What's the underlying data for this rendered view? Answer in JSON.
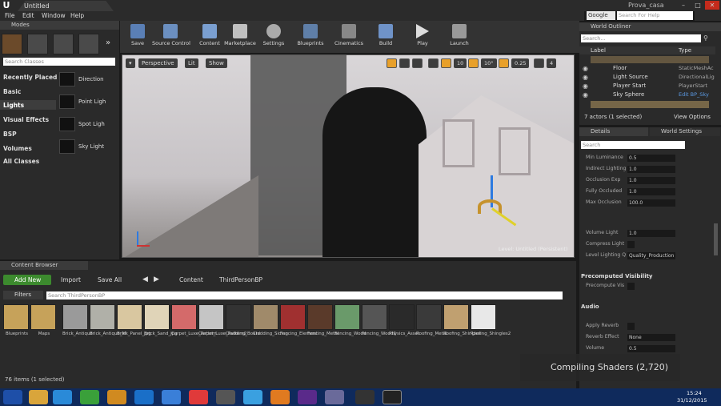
{
  "window": {
    "tab_title": "Untitled",
    "project_name": "Prova_casa",
    "minimize": "–",
    "maximize": "□",
    "close": "✕"
  },
  "menu": {
    "items": [
      "File",
      "Edit",
      "Window",
      "Help"
    ]
  },
  "topright": {
    "search_engine": "Google",
    "search_placeholder": "Search For Help"
  },
  "modes": {
    "tab_label": "Modes",
    "search_placeholder": "Search Classes",
    "categories": [
      "Recently Placed",
      "Basic",
      "Lights",
      "Visual Effects",
      "BSP",
      "Volumes",
      "All Classes"
    ],
    "lights": [
      "Direction",
      "Point Ligh",
      "Spot Ligh",
      "Sky Light"
    ]
  },
  "toolbar": {
    "buttons": [
      "Save",
      "Source Control",
      "Content",
      "Marketplace",
      "Settings",
      "Blueprints",
      "Cinematics",
      "Build",
      "Play",
      "Launch"
    ]
  },
  "viewport": {
    "perspective": "Perspective",
    "lit": "Lit",
    "show": "Show",
    "grid_snap": "10",
    "angle_snap": "10°",
    "scale_snap": "0.25",
    "camera_speed": "4",
    "level_label": "Level: Untitled (Persistent)"
  },
  "outliner": {
    "tab_label": "World Outliner",
    "search_placeholder": "Search...",
    "col_label": "Label",
    "col_type": "Type",
    "rows": [
      {
        "label": "Floor",
        "type": "StaticMeshAc"
      },
      {
        "label": "Light Source",
        "type": "DirectionalLig"
      },
      {
        "label": "Player Start",
        "type": "PlayerStart"
      },
      {
        "label": "Sky Sphere",
        "type": "Edit BP_Sky"
      }
    ],
    "status": "7 actors (1 selected)",
    "view_options": "View Options"
  },
  "details": {
    "tab_details": "Details",
    "tab_world": "World Settings",
    "search_placeholder": "Search",
    "section_precomputed": "Precomputed Visibility",
    "section_audio": "Audio",
    "rows": [
      {
        "label": "Min Luminance",
        "value": "0.5"
      },
      {
        "label": "Indirect Lighting",
        "value": "1.0"
      },
      {
        "label": "Occlusion Exp",
        "value": "1.0"
      },
      {
        "label": "Fully Occluded",
        "value": "1.0"
      },
      {
        "label": "Max Occlusion",
        "value": "100.0"
      },
      {
        "label": "Volume Light",
        "value": "1.0"
      },
      {
        "label": "Compress Light",
        "value": ""
      },
      {
        "label": "Level Lighting Q",
        "value": "Quality_Production"
      },
      {
        "label": "Precompute Vis",
        "value": ""
      },
      {
        "label": "Apply Reverb",
        "value": ""
      },
      {
        "label": "Reverb Effect",
        "value": "None"
      },
      {
        "label": "Volume",
        "value": "0.5"
      }
    ]
  },
  "content_browser": {
    "tab_label": "Content Browser",
    "add_new": "Add New",
    "import": "Import",
    "save_all": "Save All",
    "path_root": "Content",
    "path_folder": "ThirdPersonBP",
    "filters": "Filters",
    "search_placeholder": "Search ThirdPersonBP",
    "folders": [
      "Blueprints",
      "Maps"
    ],
    "assets_row1": [
      "Brick_Antique",
      "Brick_Antique_M",
      "Brick_Panel_jpg",
      "Brick_Sand_jpg",
      "Carpet_Luxe_Pattern",
      "Carpet_Luxe_Pattern2",
      "Cladding_Board",
      "Cladding_Siding",
      "Fencing_Element",
      "Fencing_Metal",
      "Fencing_Wood",
      "Fencing_Wood2",
      "Physics_Asset",
      "Roofing_Metal",
      "Roofing_Shingles",
      "Roofing_Shingles2"
    ],
    "item_count": "76 items (1 selected)"
  },
  "toast": {
    "text": "Compiling Shaders (2,720)"
  },
  "taskbar": {
    "time": "15:24",
    "date": "31/12/2015"
  }
}
